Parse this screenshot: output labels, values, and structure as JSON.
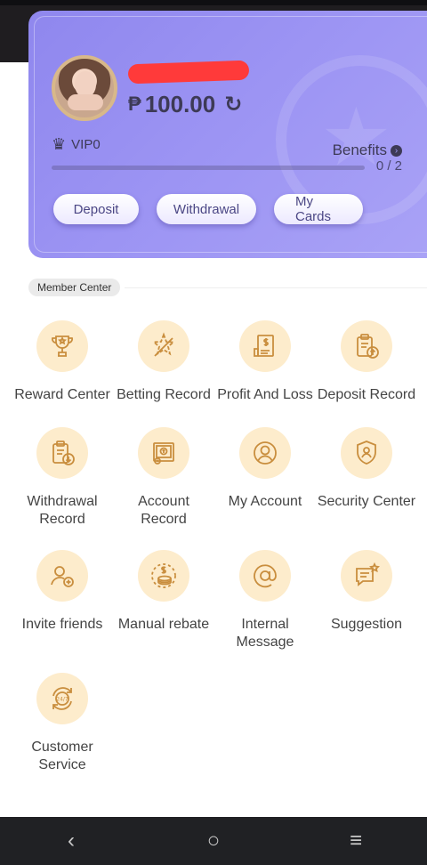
{
  "profile": {
    "balance_symbol": "₱",
    "balance": "100.00",
    "vip_level": "VIP0",
    "benefits_label": "Benefits",
    "progress_text": "0 / 2",
    "progress_fraction": 0
  },
  "actions": {
    "deposit": "Deposit",
    "withdrawal": "Withdrawal",
    "my_cards": "My Cards"
  },
  "member_center": {
    "label": "Member Center",
    "items": [
      {
        "label": "Reward Center",
        "icon": "trophy-icon"
      },
      {
        "label": "Betting Record",
        "icon": "betting-star-icon"
      },
      {
        "label": "Profit And Loss",
        "icon": "receipt-dollar-icon"
      },
      {
        "label": "Deposit Record",
        "icon": "clipboard-up-icon"
      },
      {
        "label": "Withdrawal Record",
        "icon": "clipboard-down-icon"
      },
      {
        "label": "Account Record",
        "icon": "account-record-icon"
      },
      {
        "label": "My Account",
        "icon": "user-circle-icon"
      },
      {
        "label": "Security Center",
        "icon": "shield-user-icon"
      },
      {
        "label": "Invite friends",
        "icon": "invite-user-icon"
      },
      {
        "label": "Manual rebate",
        "icon": "coin-stack-icon"
      },
      {
        "label": "Internal Message",
        "icon": "at-sign-icon"
      },
      {
        "label": "Suggestion",
        "icon": "chat-star-icon"
      },
      {
        "label": "Customer Service",
        "icon": "support-24-7-icon"
      }
    ]
  },
  "nav": {
    "back": "‹",
    "home": "○",
    "menu": "≡"
  },
  "colors": {
    "card": "#9b93f3",
    "icon_bg": "#fdeccc",
    "icon_stroke": "#d9a45a"
  }
}
